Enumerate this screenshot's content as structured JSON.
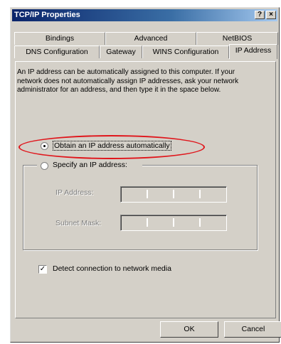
{
  "window": {
    "title": "TCP/IP Properties",
    "help_glyph": "?",
    "close_glyph": "×"
  },
  "tabs_row1": [
    {
      "label": "Bindings"
    },
    {
      "label": "Advanced"
    },
    {
      "label": "NetBIOS"
    }
  ],
  "tabs_row2": [
    {
      "label": "DNS Configuration"
    },
    {
      "label": "Gateway"
    },
    {
      "label": "WINS Configuration"
    },
    {
      "label": "IP Address",
      "selected": true
    }
  ],
  "description": "An IP address can be automatically assigned to this computer. If your network does not automatically assign IP addresses, ask your network administrator for an address, and then type it in the space below.",
  "options": {
    "obtain_auto": {
      "label": "Obtain an IP address automatically",
      "selected": true
    },
    "specify": {
      "label": "Specify an IP address:",
      "selected": false
    }
  },
  "fields": {
    "ip_address": {
      "label": "IP Address:",
      "value": ""
    },
    "subnet_mask": {
      "label": "Subnet Mask:",
      "value": ""
    }
  },
  "detect": {
    "label": "Detect connection to network media",
    "checked": true,
    "check_glyph": "✓"
  },
  "buttons": {
    "ok": "OK",
    "cancel": "Cancel"
  },
  "colors": {
    "highlight": "#e0151b",
    "titlebar": "#0a246a",
    "face": "#d4d0c8"
  }
}
